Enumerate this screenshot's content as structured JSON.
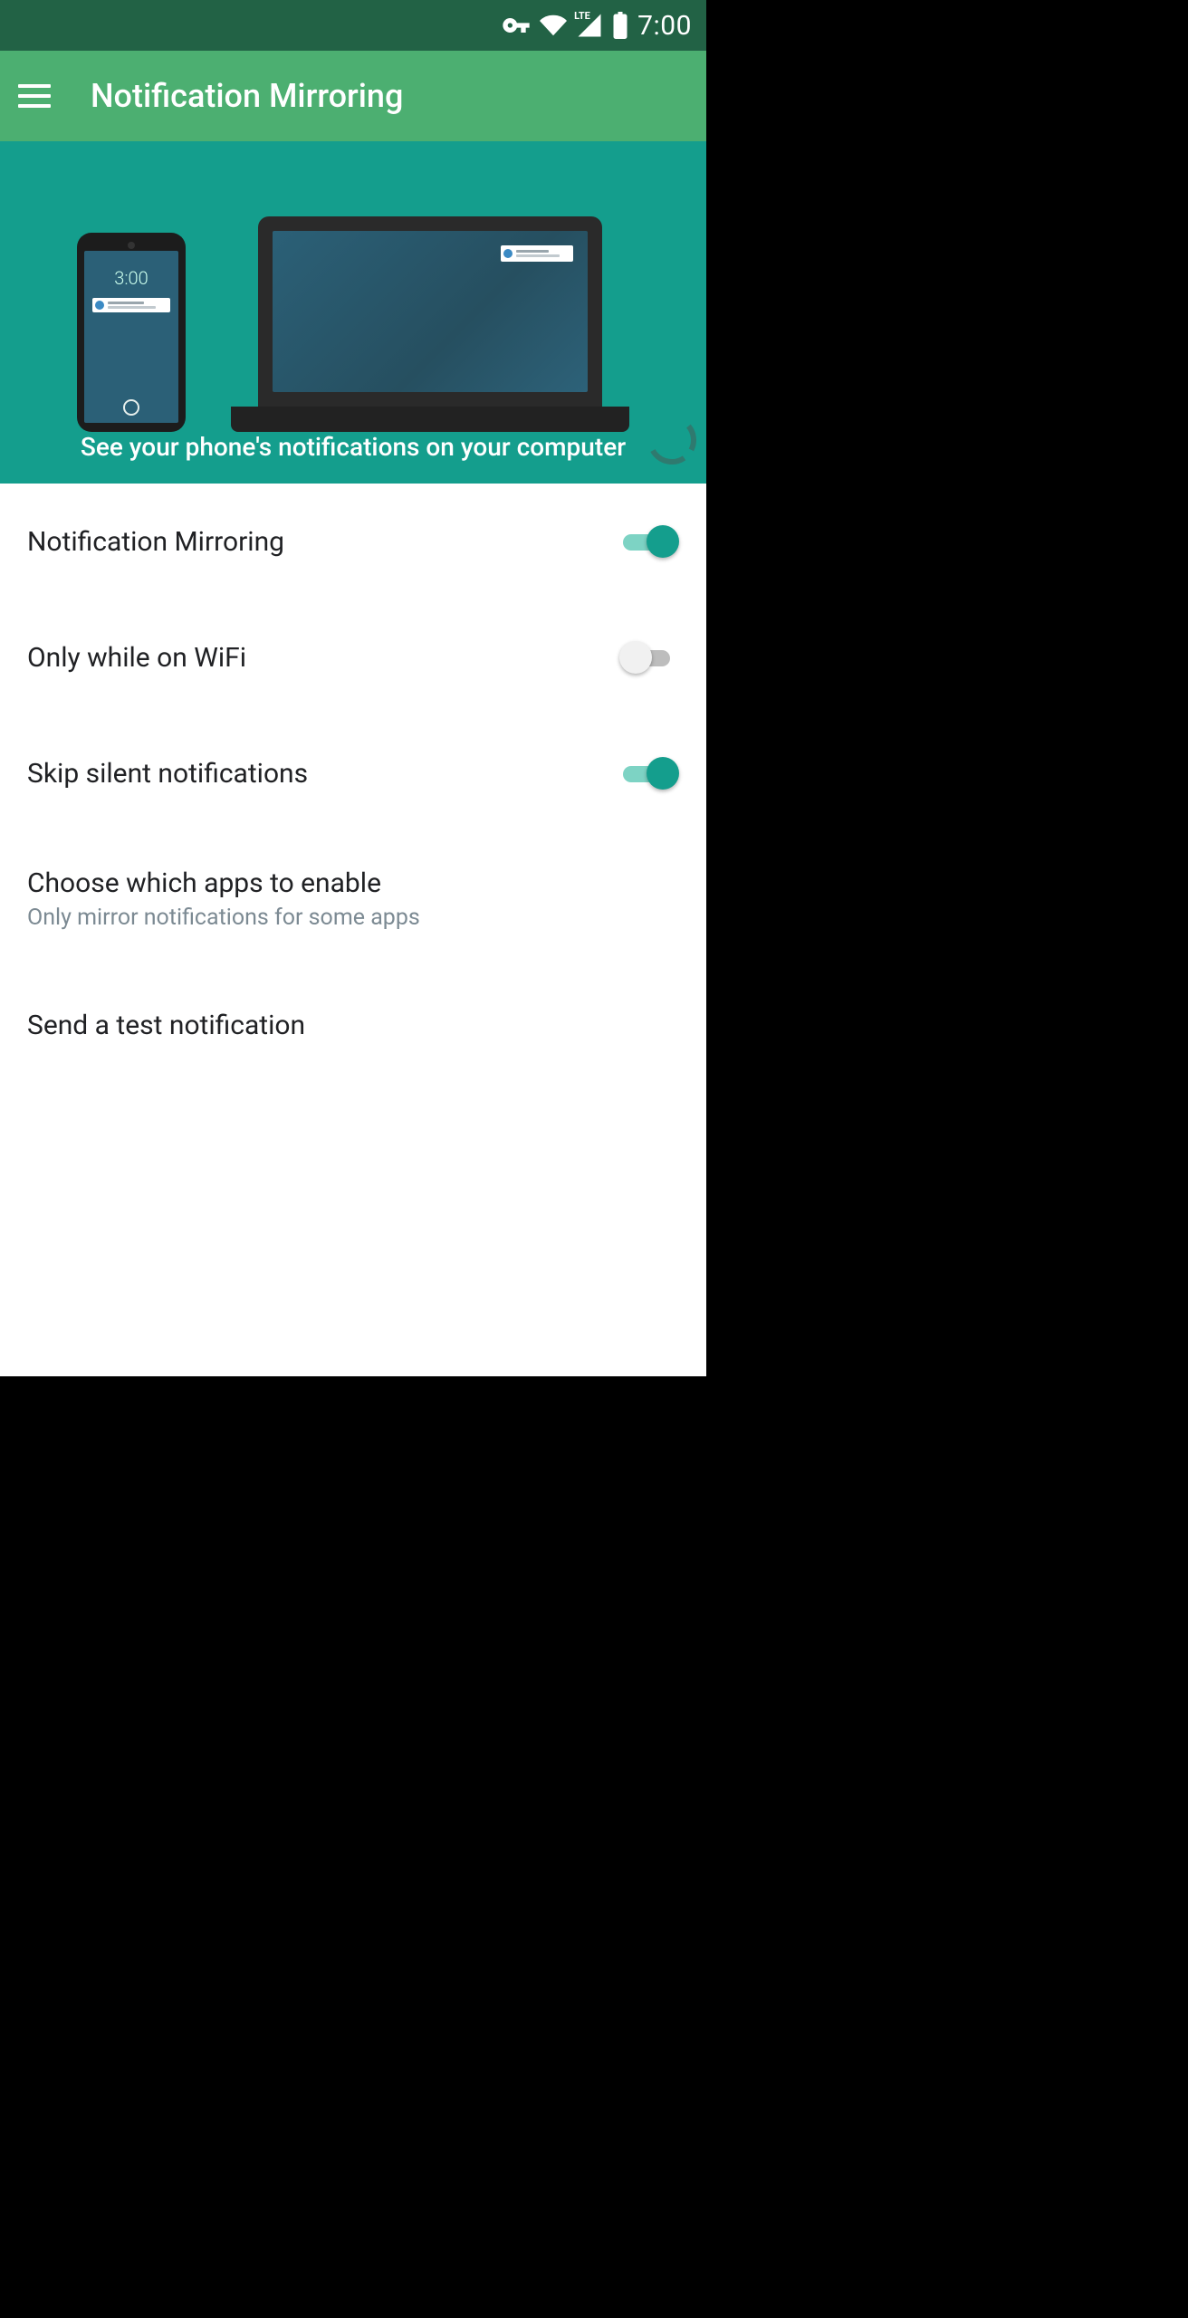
{
  "status": {
    "time": "7:00",
    "lte_label": "LTE"
  },
  "appbar": {
    "title": "Notification Mirroring"
  },
  "hero": {
    "phone_time": "3:00",
    "caption": "See your phone's notifications on your computer"
  },
  "settings": {
    "mirroring": {
      "title": "Notification Mirroring",
      "enabled": true
    },
    "wifi": {
      "title": "Only while on WiFi",
      "enabled": false
    },
    "silent": {
      "title": "Skip silent notifications",
      "enabled": true
    },
    "apps": {
      "title": "Choose which apps to enable",
      "subtitle": "Only mirror notifications for some apps"
    },
    "test": {
      "title": "Send a test notification"
    }
  },
  "colors": {
    "primary": "#149e8d",
    "appbar": "#4caf71",
    "status": "#226245"
  }
}
